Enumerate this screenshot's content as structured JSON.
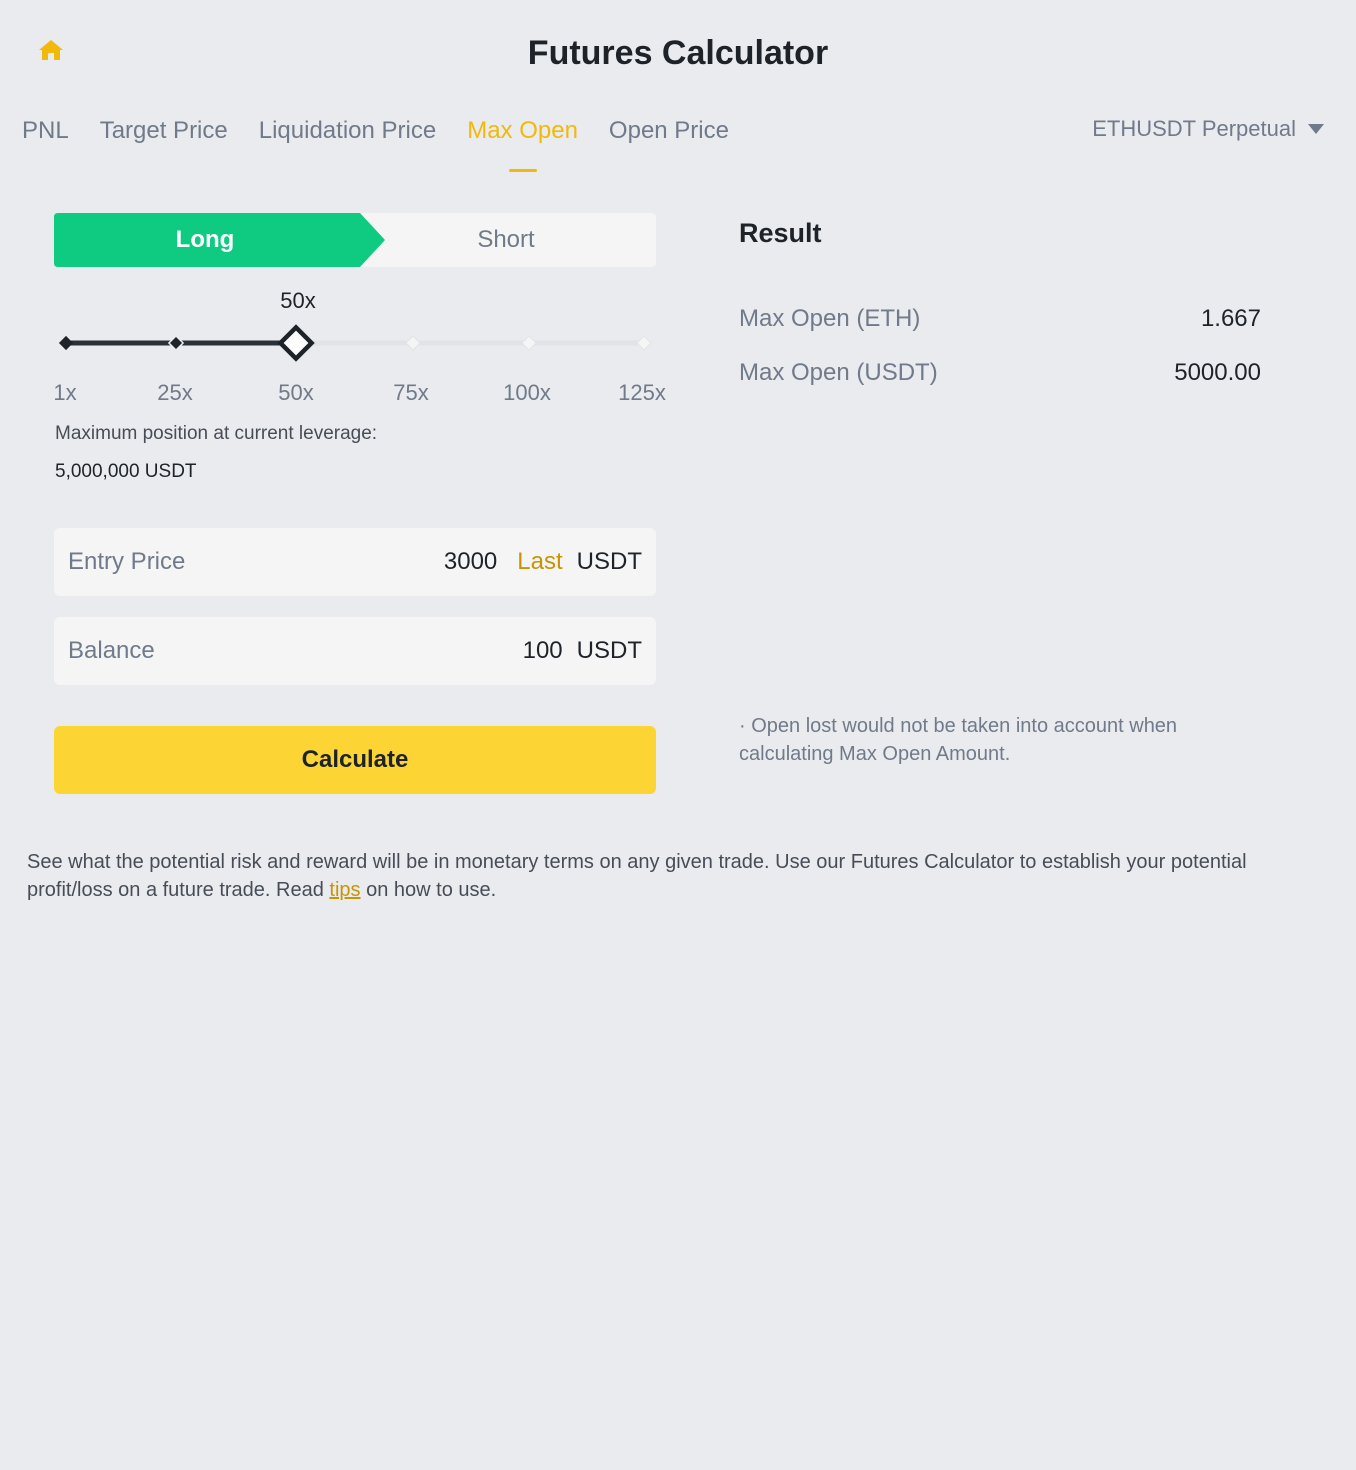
{
  "header": {
    "title": "Futures Calculator",
    "home_icon": "home-icon"
  },
  "tabs": [
    {
      "label": "PNL",
      "active": false
    },
    {
      "label": "Target Price",
      "active": false
    },
    {
      "label": "Liquidation Price",
      "active": false
    },
    {
      "label": "Max Open",
      "active": true
    },
    {
      "label": "Open Price",
      "active": false
    }
  ],
  "symbol_select": {
    "value": "ETHUSDT Perpetual",
    "icon": "caret-down-icon"
  },
  "side": {
    "long_label": "Long",
    "short_label": "Short",
    "selected": "Long"
  },
  "leverage": {
    "current_label": "50x",
    "current": 50,
    "marks": [
      "1x",
      "25x",
      "50x",
      "75x",
      "100x",
      "125x"
    ]
  },
  "max_position": {
    "label": "Maximum position at current leverage:",
    "value": "5,000,000 USDT"
  },
  "entry_price": {
    "label": "Entry Price",
    "value": "3000",
    "last_label": "Last",
    "unit": "USDT"
  },
  "balance": {
    "label": "Balance",
    "value": "100",
    "unit": "USDT"
  },
  "calculate_label": "Calculate",
  "result": {
    "title": "Result",
    "rows": [
      {
        "label": "Max Open (ETH)",
        "value": "1.667"
      },
      {
        "label": "Max Open (USDT)",
        "value": "5000.00"
      }
    ],
    "note": "· Open lost would not be taken into account when calculating Max Open Amount."
  },
  "footer": {
    "text_before": "See what the potential risk and reward will be in monetary terms on any given trade. Use our Futures Calculator to establish your potential profit/loss on a future trade. Read ",
    "link_text": "tips",
    "text_after": " on how to use."
  },
  "colors": {
    "accent": "#f0b90b",
    "long_green": "#0ecb81",
    "button_yellow": "#fcd535",
    "background": "#eaebee"
  }
}
